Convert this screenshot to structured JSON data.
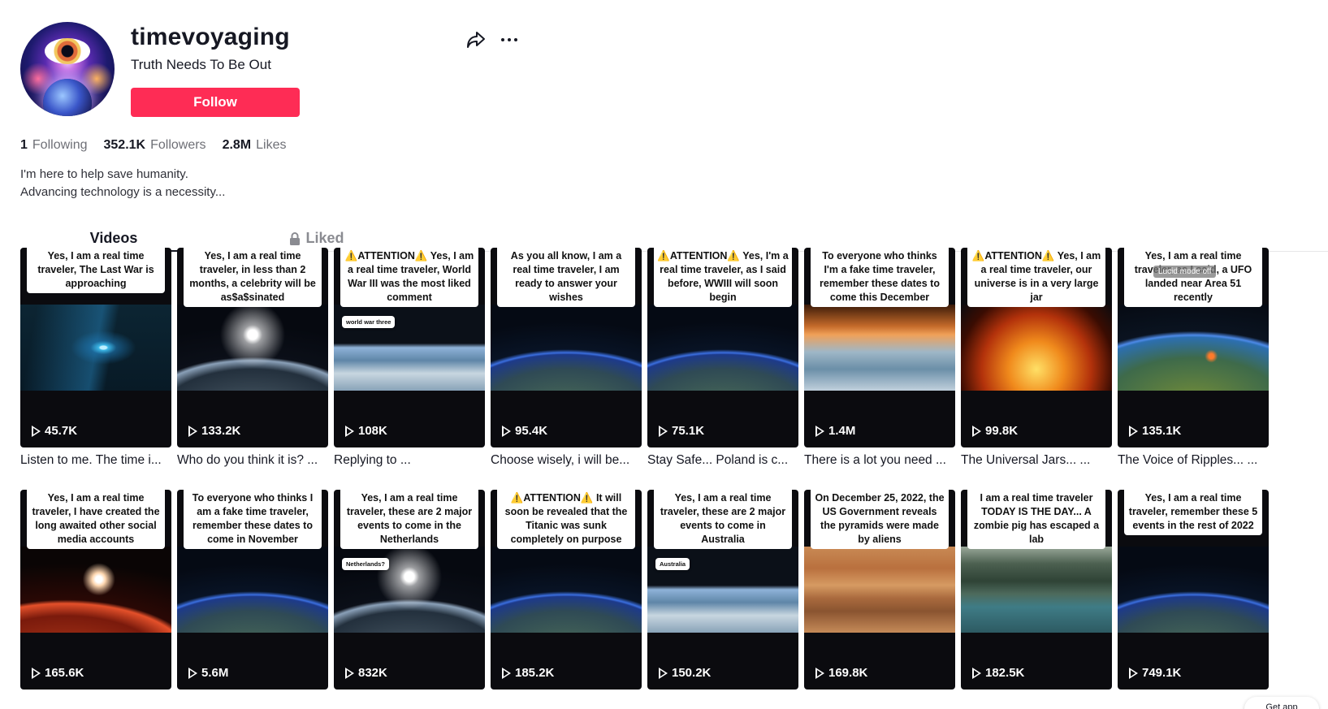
{
  "profile": {
    "username": "timevoyaging",
    "nickname": "Truth Needs To Be Out",
    "follow_label": "Follow",
    "stats": [
      {
        "value": "1",
        "label": "Following"
      },
      {
        "value": "352.1K",
        "label": "Followers"
      },
      {
        "value": "2.8M",
        "label": "Likes"
      }
    ],
    "bio_line1": "I'm here to help save humanity.",
    "bio_line2": "Advancing technology is a necessity..."
  },
  "tabs": {
    "videos": "Videos",
    "liked": "Liked"
  },
  "videos": [
    {
      "caption": "Yes, I am a real time traveler, The Last War is approaching",
      "views": "45.7K",
      "title": "Listen to me. The time i...",
      "scene": "sc-comet"
    },
    {
      "caption": "Yes, I am a real time traveler, in less than 2 months, a celebrity will be as$a$sinated",
      "views": "133.2K",
      "title": "Who do you think it is? ...",
      "scene": "sc-earth-light"
    },
    {
      "caption": "⚠️ATTENTION⚠️ Yes, I am a real time traveler, World War III was the most liked comment",
      "views": "108K",
      "title": "Replying to ...",
      "scene": "sc-earth-day",
      "reply": "world war three"
    },
    {
      "caption": "As you all know, I am a real time traveler, I am ready to answer your wishes",
      "views": "95.4K",
      "title": "Choose wisely, i will be...",
      "scene": "sc-earth"
    },
    {
      "caption": "⚠️ATTENTION⚠️ Yes, I'm a real time traveler, as I said before, WWIII will soon begin",
      "views": "75.1K",
      "title": "Stay Safe... Poland is c...",
      "scene": "sc-earth"
    },
    {
      "caption": "To everyone who thinks I'm a fake time traveler, remember these dates to come this December",
      "views": "1.4M",
      "title": "There is a lot you need ...",
      "scene": "sc-earth-warm"
    },
    {
      "caption": "⚠️ATTENTION⚠️ Yes, I am a real time traveler, our universe is in a very large jar",
      "views": "99.8K",
      "title": "The Universal Jars... ...",
      "scene": "sc-sun"
    },
    {
      "caption": "Yes, I am a real time traveler, as I said, a UFO landed near Area 51 recently",
      "views": "135.1K",
      "title": "The Voice of Ripples... ...",
      "scene": "sc-earth-green",
      "lucid": "Lucid mode off"
    },
    {
      "caption": "Yes, I am a real time traveler, I have created the long awaited other social media accounts",
      "views": "165.6K",
      "title": "",
      "scene": "sc-mars"
    },
    {
      "caption": "To everyone who thinks I am a fake time traveler, remember these dates to come in November",
      "views": "5.6M",
      "title": "",
      "scene": "sc-earth"
    },
    {
      "caption": "Yes, I am a real time traveler, these are 2 major events to come in the Netherlands",
      "views": "832K",
      "title": "",
      "scene": "sc-earth-light",
      "reply": "Netherlands?"
    },
    {
      "caption": "⚠️ATTENTION⚠️ It will soon be revealed that the Titanic was sunk completely on purpose",
      "views": "185.2K",
      "title": "",
      "scene": "sc-earth"
    },
    {
      "caption": "Yes, I am a real time traveler, these are 2 major events to come in Australia",
      "views": "150.2K",
      "title": "",
      "scene": "sc-earth-day",
      "reply": "Australia"
    },
    {
      "caption": "On December 25, 2022, the US Government reveals the pyramids were made by aliens",
      "views": "169.8K",
      "title": "",
      "scene": "sc-canyon"
    },
    {
      "caption": "I am a real time traveler TODAY IS THE DAY... A zombie pig has escaped a lab",
      "views": "182.5K",
      "title": "",
      "scene": "sc-cliffs"
    },
    {
      "caption": "Yes, I am a real time traveler, remember these 5 events in the rest of 2022",
      "views": "749.1K",
      "title": "",
      "scene": "sc-earth"
    }
  ],
  "get_app_label": "Get app"
}
